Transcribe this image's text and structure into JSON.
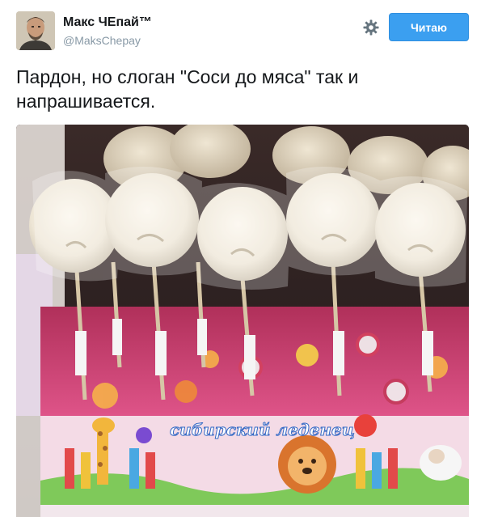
{
  "tweet": {
    "author_name": "Макс ЧЕпай™",
    "author_handle": "@MaksChepay",
    "follow_label": "Читаю",
    "text": "Пардон, но слоган \"Соси до мяса\" так и напрашивается."
  },
  "media": {
    "box_text": "сибирский леденец"
  },
  "icons": {
    "settings": "gear-icon"
  },
  "colors": {
    "accent": "#3b9ff0",
    "text": "#14171a",
    "muted": "#8899a6"
  }
}
